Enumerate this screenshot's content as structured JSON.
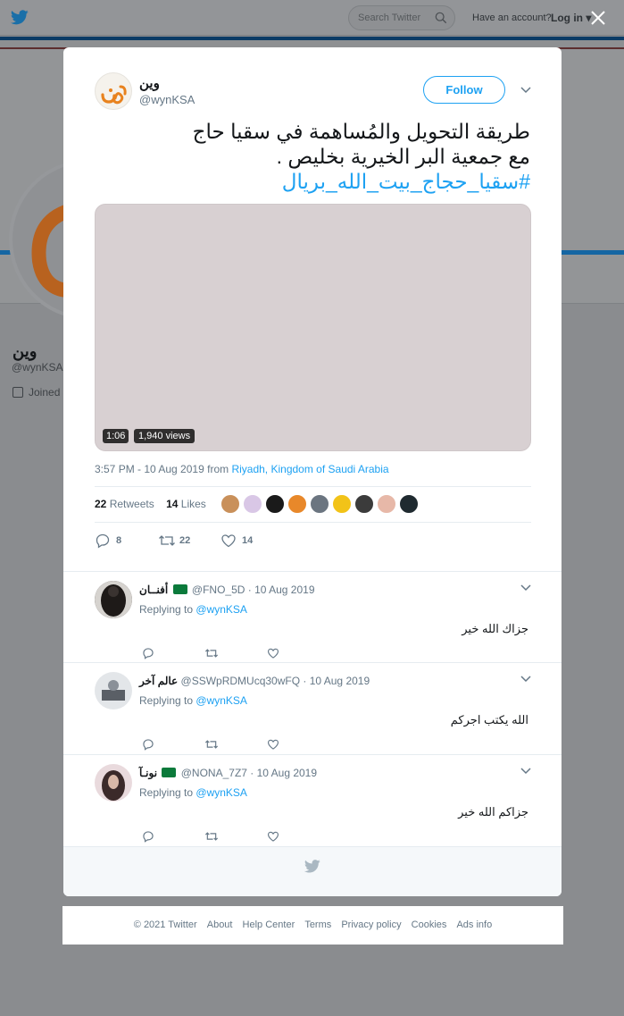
{
  "topbar": {
    "search_placeholder": "Search Twitter",
    "have_account": "Have an account?",
    "login": "Log in"
  },
  "background_profile": {
    "name": "وين",
    "handle": "@wynKSA",
    "joined": "Joined"
  },
  "tweet": {
    "author_name": "وين",
    "author_handle": "@wynKSA",
    "follow_label": "Follow",
    "text_line1": "طريقة التحويل والمُساهمة في سقيا حاج",
    "text_line2": "مع جمعية البر الخيرية بخليص .",
    "hashtag": "#سقيا_حجاج_بيت_الله_بريال",
    "media": {
      "duration": "1:06",
      "views": "1,940 views"
    },
    "meta": {
      "time": "3:57 PM - 10 Aug 2019",
      "from": "from",
      "location": "Riyadh, Kingdom of Saudi Arabia"
    },
    "stats": {
      "retweets_count": "22",
      "retweets_label": "Retweets",
      "likes_count": "14",
      "likes_label": "Likes"
    },
    "actions": {
      "replies": "8",
      "retweets": "22",
      "likes": "14"
    }
  },
  "replies": [
    {
      "name": "أفنــان",
      "handle": "@FNO_5D",
      "date": "· 10 Aug 2019",
      "replying_label": "Replying to",
      "replying_to": "@wynKSA",
      "text": "جزاك الله خير",
      "has_flag": true
    },
    {
      "name": "عالم آخر",
      "handle": "@SSWpRDMUcq30wFQ",
      "date": "· 10 Aug 2019",
      "replying_label": "Replying to",
      "replying_to": "@wynKSA",
      "text": "الله يكتب اجركم",
      "has_flag": false
    },
    {
      "name": "نونـآ",
      "handle": "@NONA_7Z7",
      "date": "· 10 Aug 2019",
      "replying_label": "Replying to",
      "replying_to": "@wynKSA",
      "text": "جزاكم الله خير",
      "has_flag": true
    }
  ],
  "footer": {
    "copyright": "© 2021 Twitter",
    "about": "About",
    "help": "Help Center",
    "terms": "Terms",
    "privacy": "Privacy policy",
    "cookies": "Cookies",
    "ads": "Ads info"
  },
  "colors": {
    "accent": "#1da1f2",
    "overlay": "#8a8c8f",
    "brand_orange": "#e8821e"
  },
  "icons": [
    "twitter-bird-icon",
    "search-icon",
    "close-icon",
    "chevron-down-icon",
    "reply-icon",
    "retweet-icon",
    "like-icon",
    "calendar-icon"
  ]
}
